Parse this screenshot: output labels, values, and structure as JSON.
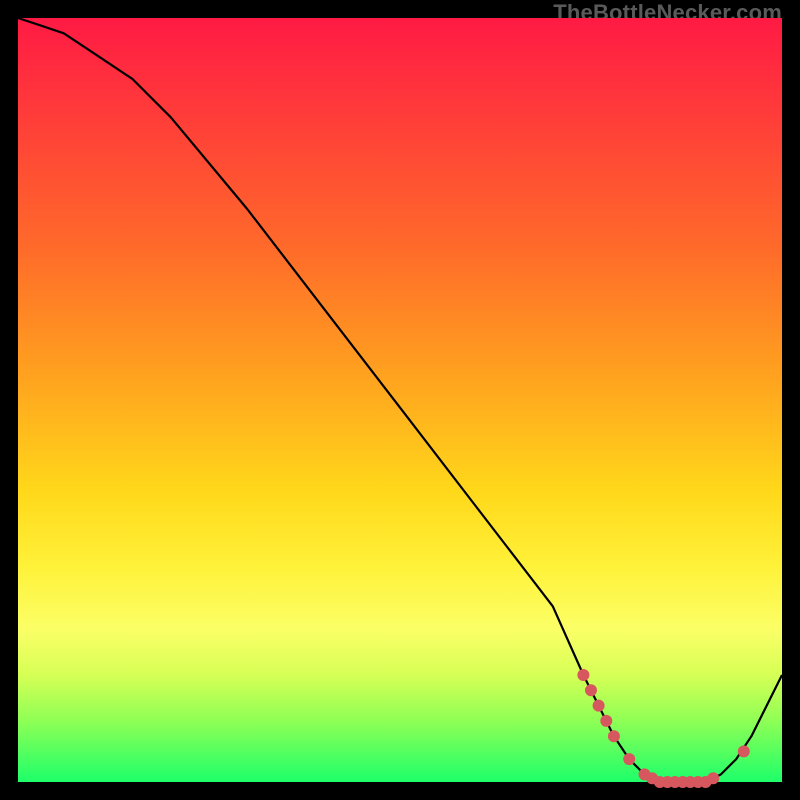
{
  "watermark": "TheBottleNecker.com",
  "chart_data": {
    "type": "line",
    "title": "",
    "xlabel": "",
    "ylabel": "",
    "xlim": [
      0,
      100
    ],
    "ylim": [
      0,
      100
    ],
    "series": [
      {
        "name": "curve",
        "x": [
          0,
          3,
          6,
          9,
          12,
          15,
          20,
          30,
          40,
          50,
          60,
          70,
          74,
          76,
          78,
          80,
          82,
          84,
          86,
          88,
          90,
          92,
          94,
          96,
          98,
          100
        ],
        "y": [
          100,
          99,
          98,
          96,
          94,
          92,
          87,
          75,
          62,
          49,
          36,
          23,
          14,
          10,
          6,
          3,
          1,
          0,
          0,
          0,
          0,
          1,
          3,
          6,
          10,
          14
        ]
      }
    ],
    "markers": [
      {
        "x": 74,
        "y": 14
      },
      {
        "x": 75,
        "y": 12
      },
      {
        "x": 76,
        "y": 10
      },
      {
        "x": 77,
        "y": 8
      },
      {
        "x": 78,
        "y": 6
      },
      {
        "x": 80,
        "y": 3
      },
      {
        "x": 82,
        "y": 1
      },
      {
        "x": 83,
        "y": 0.5
      },
      {
        "x": 84,
        "y": 0
      },
      {
        "x": 85,
        "y": 0
      },
      {
        "x": 86,
        "y": 0
      },
      {
        "x": 87,
        "y": 0
      },
      {
        "x": 88,
        "y": 0
      },
      {
        "x": 89,
        "y": 0
      },
      {
        "x": 90,
        "y": 0
      },
      {
        "x": 91,
        "y": 0.5
      },
      {
        "x": 95,
        "y": 4
      }
    ],
    "colors": {
      "curve": "#000000",
      "markers": "#d7575f"
    }
  }
}
